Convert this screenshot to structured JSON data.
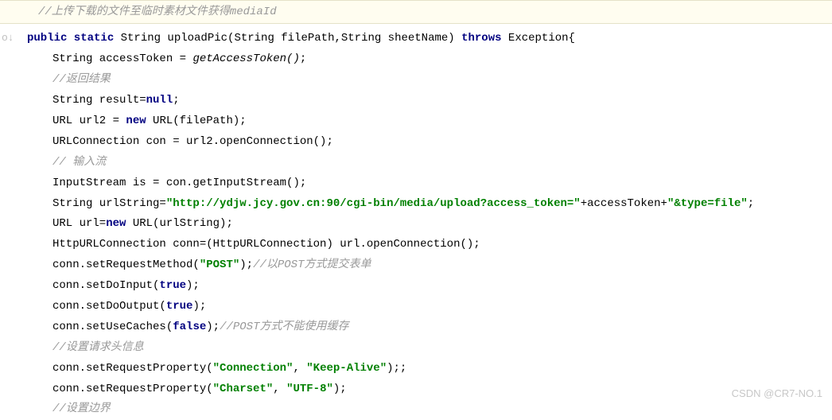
{
  "code": {
    "top_comment": "//上传下载的文件至临时素材文件获得mediaId",
    "sig_pre": "public static",
    "sig_ret": " String uploadPic(String filePath,String sheetName) ",
    "sig_throws": "throws",
    "sig_post": " Exception{",
    "l2_a": "String accessToken = ",
    "l2_b_it": "getAccessToken()",
    "l2_c": ";",
    "l3_cmt": "//返回结果",
    "l4_a": "String result=",
    "l4_b_kw": "null",
    "l4_c": ";",
    "l5_a": "URL url2 = ",
    "l5_b_kw": "new",
    "l5_c": " URL(filePath);",
    "l6": "URLConnection con = url2.openConnection();",
    "l7_cmt": "// 输入流",
    "l8": "InputStream is = con.getInputStream();",
    "l9_a": "String urlString=",
    "l9_b_str": "\"http://ydjw.jcy.gov.cn:90/cgi-bin/media/upload?access_token=\"",
    "l9_c": "+accessToken+",
    "l9_d_str": "\"&type=file\"",
    "l9_e": ";",
    "l10_a": "URL url=",
    "l10_b_kw": "new",
    "l10_c": " URL(urlString);",
    "l11": "HttpURLConnection conn=(HttpURLConnection) url.openConnection();",
    "l12_a": "conn.setRequestMethod(",
    "l12_b_str": "\"POST\"",
    "l12_c": ");",
    "l12_d_cmt": "//以POST方式提交表单",
    "l13_a": "conn.setDoInput(",
    "l13_b_kw": "true",
    "l13_c": ");",
    "l14_a": "conn.setDoOutput(",
    "l14_b_kw": "true",
    "l14_c": ");",
    "l15_a": "conn.setUseCaches(",
    "l15_b_kw": "false",
    "l15_c": ");",
    "l15_d_cmt": "//POST方式不能使用缓存",
    "l16_cmt": "//设置请求头信息",
    "l17_a": "conn.setRequestProperty(",
    "l17_b_str": "\"Connection\"",
    "l17_c": ", ",
    "l17_d_str": "\"Keep-Alive\"",
    "l17_e": ");;",
    "l18_a": "conn.setRequestProperty(",
    "l18_b_str": "\"Charset\"",
    "l18_c": ", ",
    "l18_d_str": "\"UTF-8\"",
    "l18_e": ");",
    "l19_cmt": "//设置边界"
  },
  "watermark": "CSDN @CR7-NO.1"
}
